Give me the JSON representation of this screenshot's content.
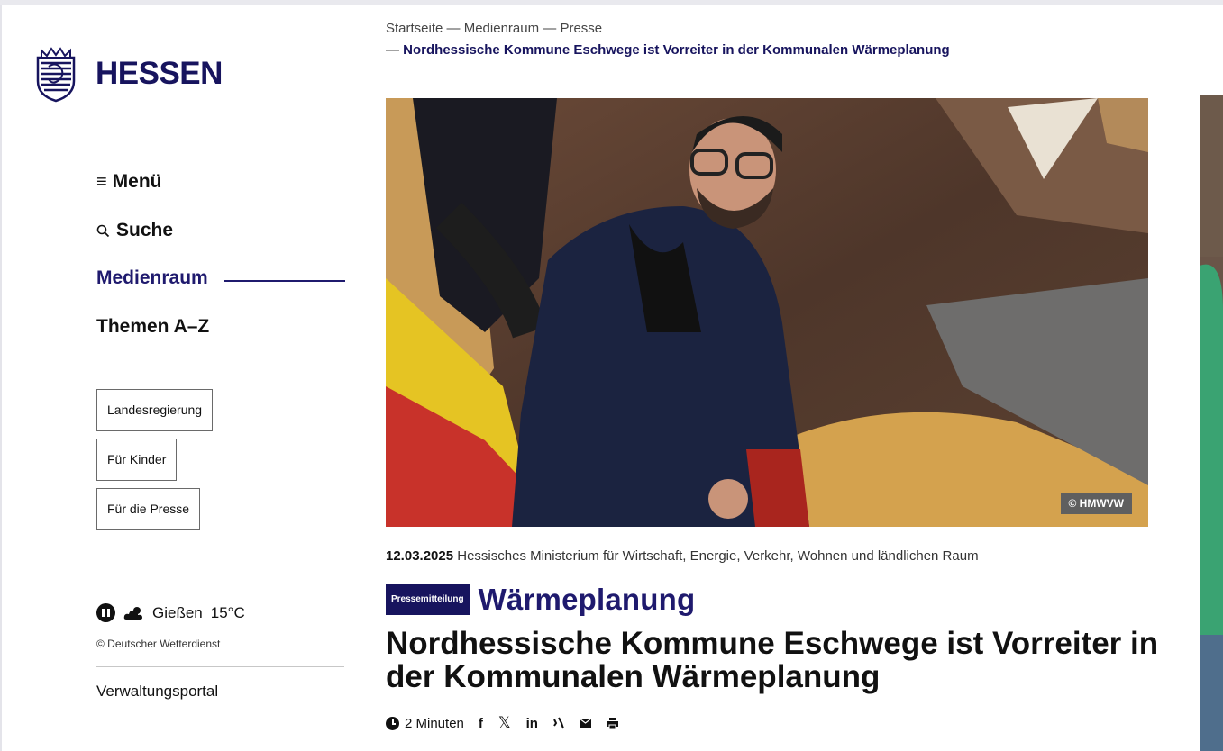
{
  "site": {
    "logo_text": "HESSEN"
  },
  "nav": {
    "menu": "Menü",
    "search": "Suche",
    "medienraum": "Medienraum",
    "themen": "Themen A–Z"
  },
  "side_buttons": [
    "Landesregierung",
    "Für Kinder",
    "Für die Presse"
  ],
  "weather": {
    "city": "Gießen",
    "temp": "15°C",
    "credit": "© Deutscher Wetterdienst"
  },
  "footer_link": "Verwaltungsportal",
  "breadcrumb": {
    "items": [
      "Startseite",
      "Medienraum",
      "Presse"
    ],
    "current": "Nordhessische Kommune Eschwege ist Vorreiter in der Kommunalen Wärmeplanung",
    "separator": "—"
  },
  "image": {
    "copyright": "© HMWVW"
  },
  "article": {
    "date": "12.03.2025",
    "ministry": "Hessisches Ministerium für Wirtschaft, Energie, Verkehr, Wohnen und ländlichen Raum",
    "badge": "Pressemitteilung",
    "topic": "Wärmeplanung",
    "title": "Nordhessische Kommune Eschwege ist Vorreiter in der Kommunalen Wärmeplanung",
    "reading_time": "2 Minuten"
  },
  "share_icons": [
    "facebook-icon",
    "x-icon",
    "linkedin-icon",
    "xing-icon",
    "mail-icon",
    "print-icon"
  ],
  "colors": {
    "brand": "#17145e",
    "accent": "#1f1a6e"
  }
}
